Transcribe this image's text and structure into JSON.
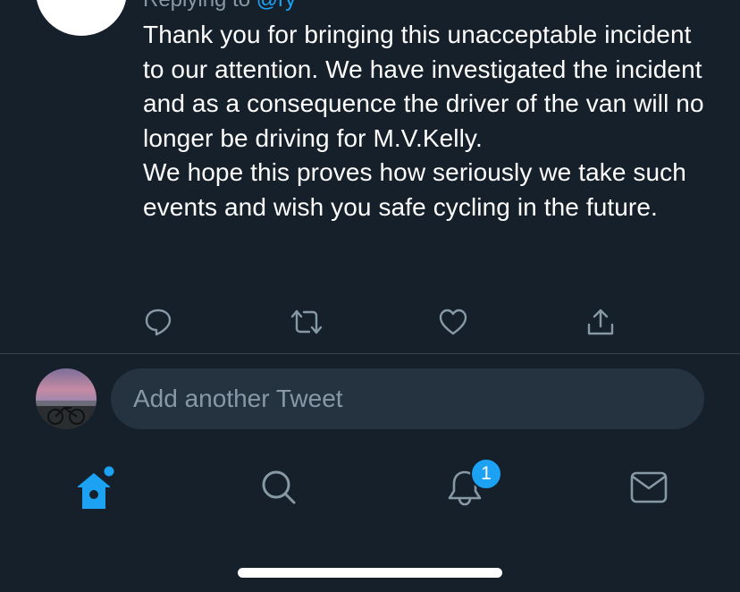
{
  "reply_header": {
    "prefix": "Replying to",
    "handle": "@ry"
  },
  "tweet": {
    "paragraphs": [
      "Thank you for bringing this unacceptable incident to our attention. We have investigated the incident and as a consequence the driver of the van will no longer be driving for M.V.Kelly.",
      "We hope this proves how seriously we take such events and wish you safe cycling in the future."
    ]
  },
  "actions": {
    "reply_icon": "reply-icon",
    "retweet_icon": "retweet-icon",
    "like_icon": "heart-icon",
    "share_icon": "share-icon"
  },
  "compose": {
    "placeholder": "Add another Tweet"
  },
  "tabbar": {
    "home_icon": "home-icon",
    "search_icon": "search-icon",
    "notifications_icon": "bell-icon",
    "notifications_badge": "1",
    "messages_icon": "mail-icon"
  },
  "colors": {
    "background": "#15202b",
    "accent": "#1da1f2",
    "secondary_text": "#8899a6",
    "divider": "#38444d",
    "compose_bg": "#253341"
  }
}
